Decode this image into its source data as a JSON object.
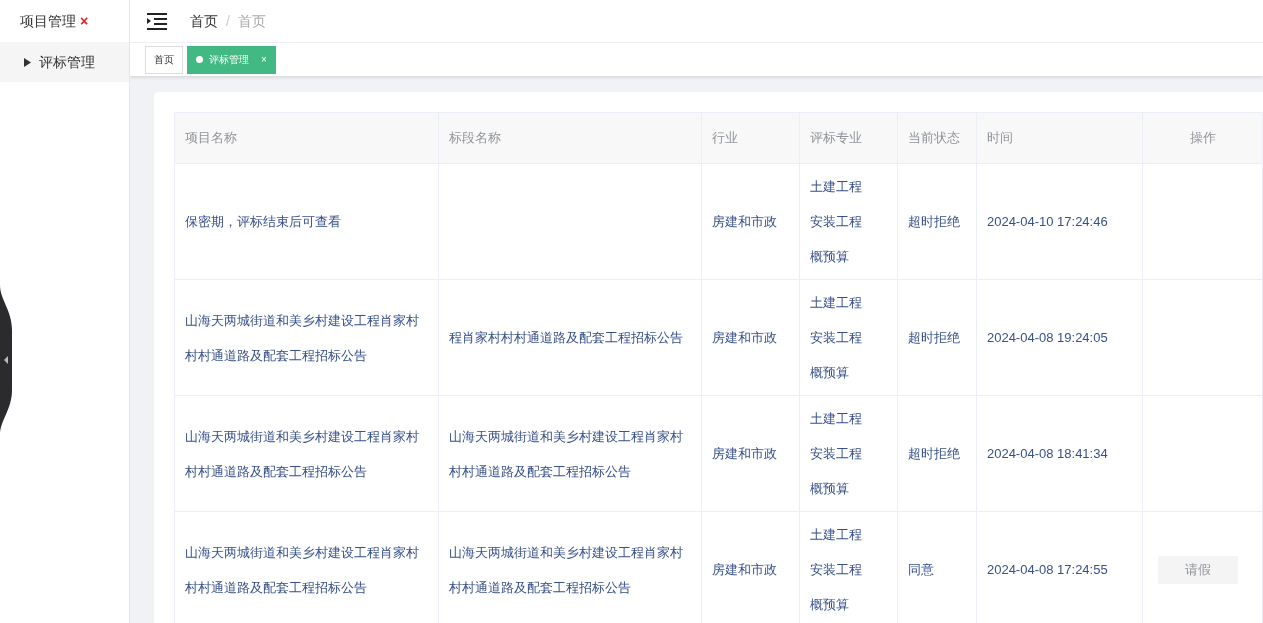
{
  "sidebar": {
    "title": "项目管理",
    "close_mark": "×",
    "items": [
      {
        "label": "评标管理",
        "expanded": false
      }
    ]
  },
  "breadcrumb": {
    "items": [
      {
        "label": "首页",
        "current": false
      },
      {
        "label": "首页",
        "current": true
      }
    ],
    "separator": "/"
  },
  "tabs": [
    {
      "label": "首页",
      "selected": false,
      "closable": false
    },
    {
      "label": "评标管理",
      "selected": true,
      "closable": true,
      "close": "×"
    }
  ],
  "table": {
    "columns": [
      "项目名称",
      "标段名称",
      "行业",
      "评标专业",
      "当前状态",
      "时间",
      "操作"
    ],
    "rows": [
      {
        "project": "保密期，评标结束后可查看",
        "section": "",
        "industry": "房建和市政",
        "specialties": [
          "土建工程",
          "安装工程",
          "概预算"
        ],
        "status": "超时拒绝",
        "time": "2024-04-10 17:24:46"
      },
      {
        "project": "山海天两城街道和美乡村建设工程肖家村村村通道路及配套工程招标公告",
        "section": "程肖家村村村通道路及配套工程招标公告",
        "industry": "房建和市政",
        "specialties": [
          "土建工程",
          "安装工程",
          "概预算"
        ],
        "status": "超时拒绝",
        "time": "2024-04-08 19:24:05"
      },
      {
        "project": "山海天两城街道和美乡村建设工程肖家村村村通道路及配套工程招标公告",
        "section": "山海天两城街道和美乡村建设工程肖家村村村通道路及配套工程招标公告",
        "industry": "房建和市政",
        "specialties": [
          "土建工程",
          "安装工程",
          "概预算"
        ],
        "status": "超时拒绝",
        "time": "2024-04-08 18:41:34"
      },
      {
        "project": "山海天两城街道和美乡村建设工程肖家村村村通道路及配套工程招标公告",
        "section": "山海天两城街道和美乡村建设工程肖家村村村通道路及配套工程招标公告",
        "industry": "房建和市政",
        "specialties": [
          "土建工程",
          "安装工程",
          "概预算"
        ],
        "status": "同意",
        "time": "2024-04-08 17:24:55",
        "action": "请假"
      }
    ]
  }
}
